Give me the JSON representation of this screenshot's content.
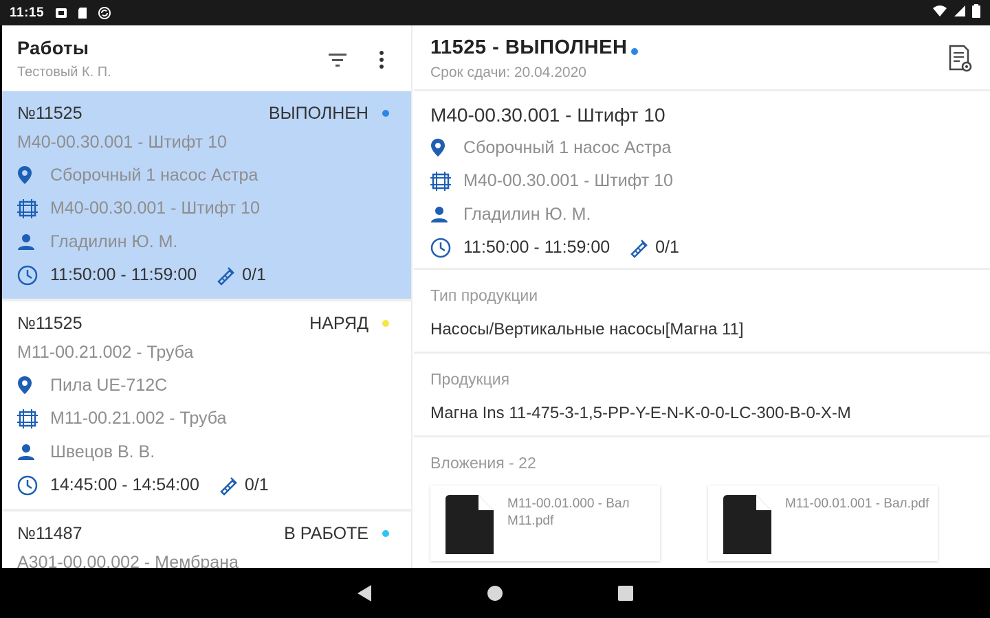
{
  "status_bar": {
    "time": "11:15"
  },
  "colors": {
    "accent_blue": "#1e5fb4",
    "selected_bg": "#bcd6f7",
    "dot_blue": "#2a86e8",
    "dot_yellow": "#f5e642",
    "dot_cyan": "#29c6f2"
  },
  "left": {
    "title": "Работы",
    "subtitle": "Тестовый К. П.",
    "cards": [
      {
        "order": "№11525",
        "status": "ВЫПОЛНЕН",
        "dot_color": "#2a86e8",
        "part": "M40-00.30.001 - Штифт 10",
        "location": "Сборочный 1 насос Астра",
        "drawing": "M40-00.30.001 - Штифт 10",
        "worker": "Гладилин Ю. М.",
        "time": "11:50:00 - 11:59:00",
        "progress": "0/1"
      },
      {
        "order": "№11525",
        "status": "НАРЯД",
        "dot_color": "#f5e642",
        "part": "M11-00.21.002 - Труба",
        "location": "Пила UE-712C",
        "drawing": "M11-00.21.002 - Труба",
        "worker": "Швецов В. В.",
        "time": "14:45:00 - 14:54:00",
        "progress": "0/1"
      },
      {
        "order": "№11487",
        "status": "В РАБОТЕ",
        "dot_color": "#29c6f2",
        "part": "А301-00.00.002 - Мембрана"
      }
    ]
  },
  "right": {
    "title": "11525 - ВЫПОЛНЕН",
    "due": "Срок сдачи: 20.04.2020",
    "headline": "M40-00.30.001 - Штифт 10",
    "location": "Сборочный 1 насос Астра",
    "drawing": "M40-00.30.001 - Штифт 10",
    "worker": "Гладилин Ю. М.",
    "time": "11:50:00 - 11:59:00",
    "progress": "0/1",
    "product_type_label": "Тип продукции",
    "product_type_value": "Насосы/Вертикальные насосы[Магна 11]",
    "product_label": "Продукция",
    "product_value": "Магна Ins 11-475-3-1,5-PP-Y-E-N-K-0-0-LC-300-B-0-X-M",
    "attachments_label": "Вложения - 22",
    "attachments": [
      {
        "name": "M11-00.01.000 - Вал M11.pdf"
      },
      {
        "name": "M11-00.01.001 - Вал.pdf"
      }
    ]
  }
}
